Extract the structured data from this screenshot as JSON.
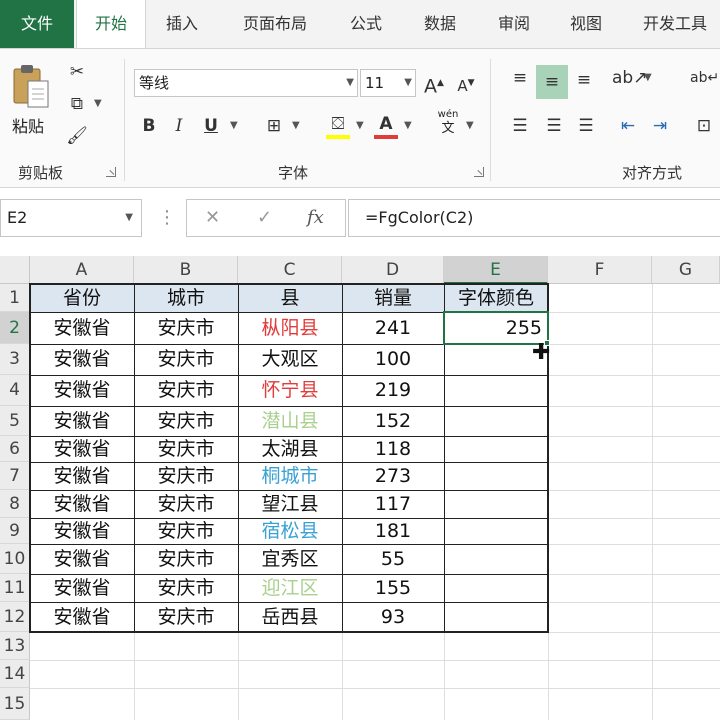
{
  "ribbon_tabs": [
    "文件",
    "开始",
    "插入",
    "页面布局",
    "公式",
    "数据",
    "审阅",
    "视图",
    "开发工具"
  ],
  "clipboard": {
    "paste_label": "粘贴",
    "group_label": "剪贴板"
  },
  "font": {
    "name": "等线",
    "size": "11",
    "group_label": "字体",
    "phonetic_top": "wén",
    "phonetic_bottom": "文"
  },
  "alignment": {
    "group_label": "对齐方式"
  },
  "formula_bar": {
    "name_box": "E2",
    "formula": "=FgColor(C2)"
  },
  "columns": [
    "A",
    "B",
    "C",
    "D",
    "E",
    "F",
    "G"
  ],
  "rows": [
    "1",
    "2",
    "3",
    "4",
    "5",
    "6",
    "7",
    "8",
    "9",
    "10",
    "11",
    "12",
    "13",
    "14",
    "15"
  ],
  "table": {
    "headers": [
      "省份",
      "城市",
      "县",
      "销量",
      "字体颜色"
    ],
    "rows": [
      {
        "province": "安徽省",
        "city": "安庆市",
        "county": "枞阳县",
        "sales": "241",
        "color_value": "255",
        "county_color": "#e03c3c"
      },
      {
        "province": "安徽省",
        "city": "安庆市",
        "county": "大观区",
        "sales": "100",
        "color_value": "",
        "county_color": "#111111"
      },
      {
        "province": "安徽省",
        "city": "安庆市",
        "county": "怀宁县",
        "sales": "219",
        "color_value": "",
        "county_color": "#e03c3c"
      },
      {
        "province": "安徽省",
        "city": "安庆市",
        "county": "潜山县",
        "sales": "152",
        "color_value": "",
        "county_color": "#a9d08e"
      },
      {
        "province": "安徽省",
        "city": "安庆市",
        "county": "太湖县",
        "sales": "118",
        "color_value": "",
        "county_color": "#111111"
      },
      {
        "province": "安徽省",
        "city": "安庆市",
        "county": "桐城市",
        "sales": "273",
        "color_value": "",
        "county_color": "#3aa1d4"
      },
      {
        "province": "安徽省",
        "city": "安庆市",
        "county": "望江县",
        "sales": "117",
        "color_value": "",
        "county_color": "#111111"
      },
      {
        "province": "安徽省",
        "city": "安庆市",
        "county": "宿松县",
        "sales": "181",
        "color_value": "",
        "county_color": "#3aa1d4"
      },
      {
        "province": "安徽省",
        "city": "安庆市",
        "county": "宜秀区",
        "sales": "55",
        "color_value": "",
        "county_color": "#111111"
      },
      {
        "province": "安徽省",
        "city": "安庆市",
        "county": "迎江区",
        "sales": "155",
        "color_value": "",
        "county_color": "#a9d08e"
      },
      {
        "province": "安徽省",
        "city": "安庆市",
        "county": "岳西县",
        "sales": "93",
        "color_value": "",
        "county_color": "#111111"
      }
    ]
  },
  "colors": {
    "accent": "#217346",
    "header_fill": "#dce6f1"
  }
}
